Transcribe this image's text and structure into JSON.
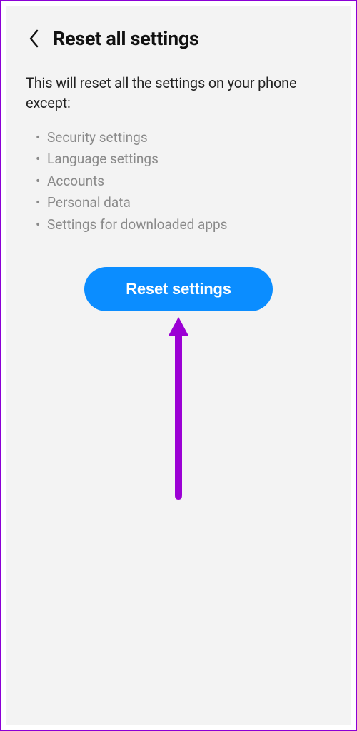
{
  "header": {
    "title": "Reset all settings"
  },
  "description": "This will reset all the settings on your phone except:",
  "exceptions": [
    "Security settings",
    "Language settings",
    "Accounts",
    "Personal data",
    "Settings for downloaded apps"
  ],
  "button": {
    "label": "Reset settings"
  },
  "colors": {
    "primary_button": "#0b8dff",
    "annotation": "#9b00d4",
    "border": "#8b00d6"
  }
}
